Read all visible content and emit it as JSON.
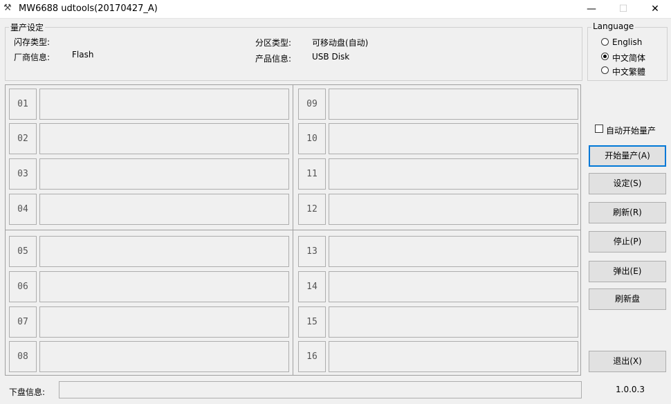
{
  "window": {
    "title": "MW6688 udtools(20170427_A)",
    "minimize_glyph": "—",
    "maximize_glyph": "☐",
    "close_glyph": "✕"
  },
  "settings": {
    "legend": "量产设定",
    "flash_type_label": "闪存类型:",
    "flash_type_value": "",
    "vendor_label": "厂商信息:",
    "vendor_value": "Flash",
    "partition_label": "分区类型:",
    "partition_value": "可移动盘(自动)",
    "product_label": "产品信息:",
    "product_value": "USB Disk"
  },
  "language": {
    "legend": "Language",
    "options": [
      "English",
      "中文简体",
      "中文繁體"
    ],
    "selected": "中文简体"
  },
  "slots": [
    "01",
    "02",
    "03",
    "04",
    "05",
    "06",
    "07",
    "08",
    "09",
    "10",
    "11",
    "12",
    "13",
    "14",
    "15",
    "16"
  ],
  "auto_start": {
    "label": "自动开始量产",
    "checked": false
  },
  "buttons": {
    "start": "开始量产(A)",
    "settings": "设定(S)",
    "refresh": "刷新(R)",
    "stop": "停止(P)",
    "eject": "弹出(E)",
    "refresh_disk": "刷新盘",
    "exit": "退出(X)"
  },
  "status": {
    "label": "下盘信息:",
    "value": ""
  },
  "version": "1.0.0.3"
}
